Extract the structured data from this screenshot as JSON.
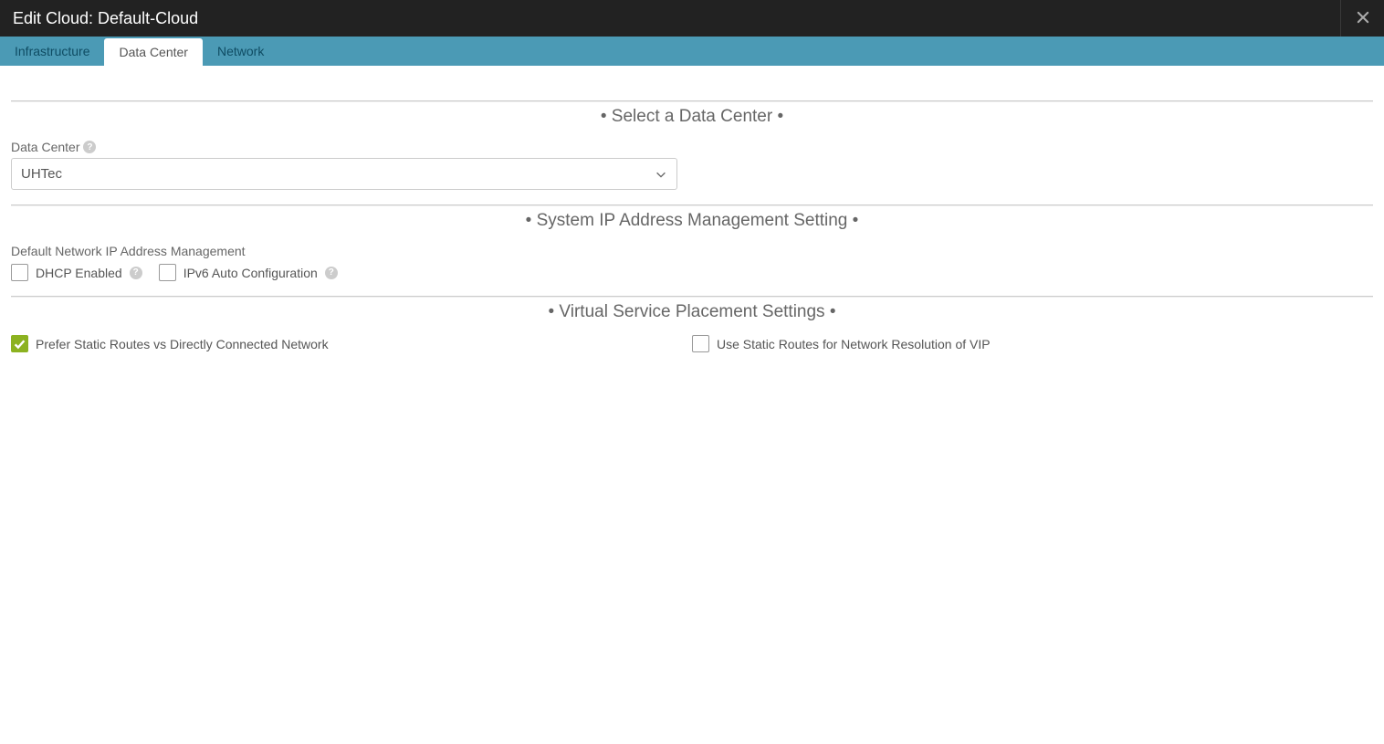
{
  "header": {
    "title": "Edit Cloud: Default-Cloud"
  },
  "tabs": {
    "items": [
      {
        "label": "Infrastructure",
        "active": false
      },
      {
        "label": "Data Center",
        "active": true
      },
      {
        "label": "Network",
        "active": false
      }
    ]
  },
  "sections": {
    "select_dc": {
      "title": "• Select a Data Center •",
      "field_label": "Data Center",
      "value": "UHTec"
    },
    "ipam": {
      "title": "• System IP Address Management Setting •",
      "sublabel": "Default Network IP Address Management",
      "dhcp_label": "DHCP Enabled",
      "ipv6_label": "IPv6 Auto Configuration",
      "dhcp_checked": false,
      "ipv6_checked": false
    },
    "vsp": {
      "title": "• Virtual Service Placement Settings •",
      "prefer_label": "Prefer Static Routes vs Directly Connected Network",
      "static_label": "Use Static Routes for Network Resolution of VIP",
      "prefer_checked": true,
      "static_checked": false
    }
  }
}
